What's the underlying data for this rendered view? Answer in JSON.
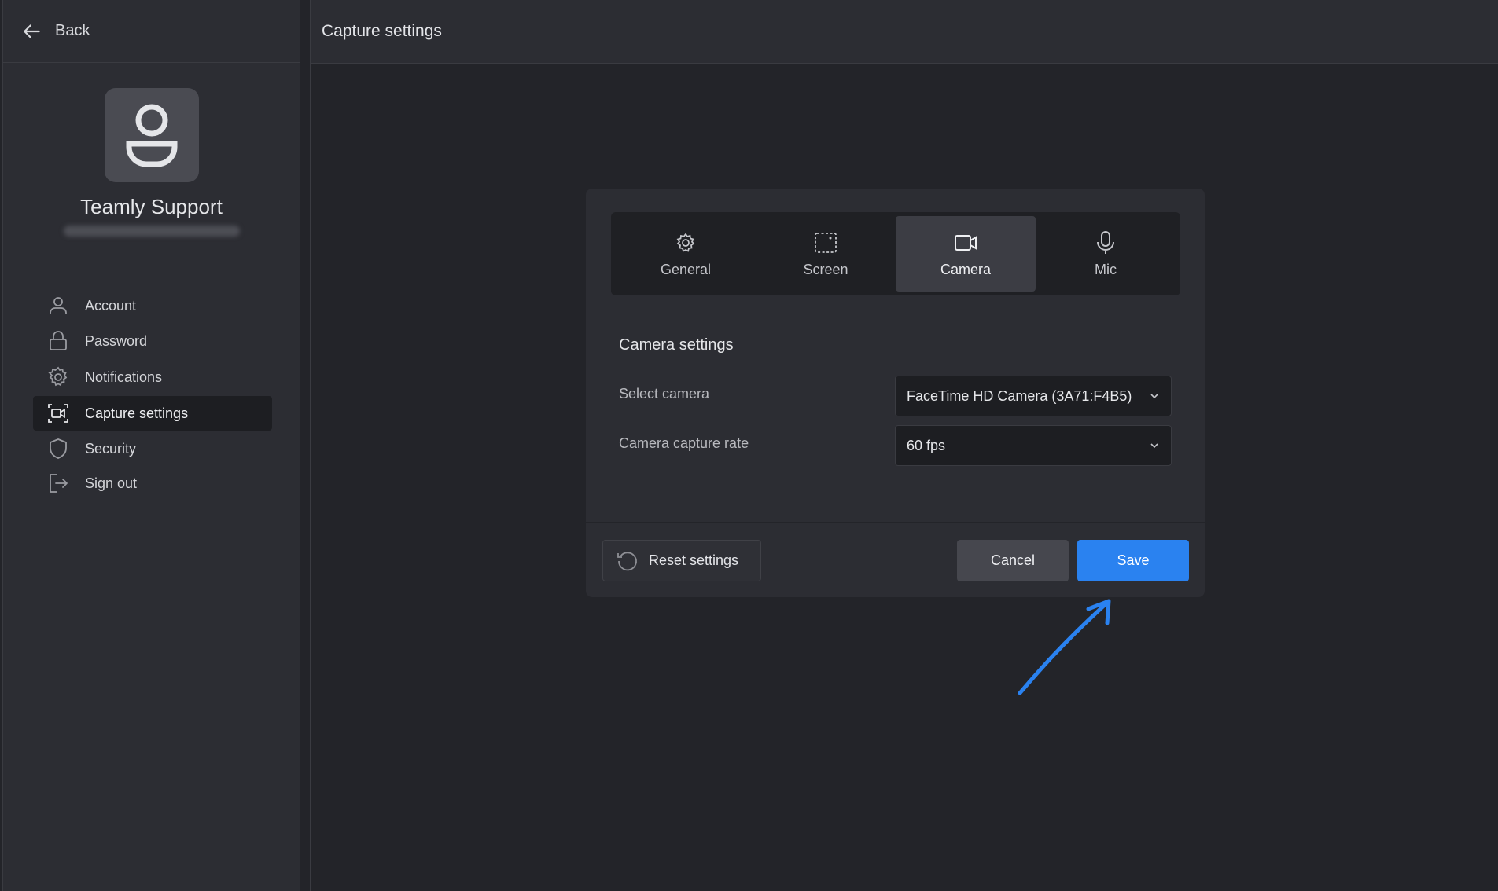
{
  "sidebar": {
    "back_label": "Back",
    "profile": {
      "name": "Teamly Support"
    },
    "items": [
      {
        "label": "Account",
        "icon": "user-icon"
      },
      {
        "label": "Password",
        "icon": "lock-icon"
      },
      {
        "label": "Notifications",
        "icon": "gear-icon"
      },
      {
        "label": "Capture settings",
        "icon": "capture-icon",
        "active": true
      },
      {
        "label": "Security",
        "icon": "shield-icon"
      },
      {
        "label": "Sign out",
        "icon": "sign-out-icon"
      }
    ]
  },
  "header": {
    "title": "Capture settings"
  },
  "dialog": {
    "tabs": [
      {
        "label": "General",
        "icon": "gear-icon"
      },
      {
        "label": "Screen",
        "icon": "screen-capture-icon"
      },
      {
        "label": "Camera",
        "icon": "camera-icon",
        "active": true
      },
      {
        "label": "Mic",
        "icon": "microphone-icon"
      }
    ],
    "section_title": "Camera settings",
    "fields": [
      {
        "label": "Select camera",
        "value": "FaceTime HD Camera (3A71:F4B5)"
      },
      {
        "label": "Camera capture rate",
        "value": "60 fps"
      }
    ],
    "reset_label": "Reset settings",
    "cancel_label": "Cancel",
    "save_label": "Save"
  },
  "colors": {
    "accent": "#2a82f0",
    "background": "#232429",
    "panel": "#2c2d33"
  }
}
